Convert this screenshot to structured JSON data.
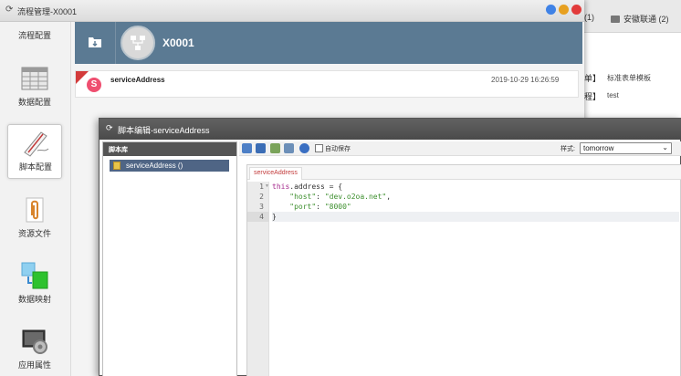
{
  "background": {
    "tabs": [
      {
        "label": "安徽联通 (2)"
      }
    ],
    "tab_count_partial": "(1)",
    "rows": [
      {
        "key": "单】",
        "value": "标准表单模板"
      },
      {
        "key": "程】",
        "value": "test"
      }
    ]
  },
  "flow_window": {
    "title": "流程管理-X0001",
    "nav": [
      {
        "label": "流程配置"
      },
      {
        "label": "数据配置"
      },
      {
        "label": "脚本配置"
      },
      {
        "label": "资源文件"
      },
      {
        "label": "数据映射"
      },
      {
        "label": "应用属性"
      }
    ],
    "header_title": "X0001",
    "script_row": {
      "name": "serviceAddress",
      "date": "2019-10-29 16:26:59"
    }
  },
  "editor_window": {
    "title": "脚本编辑-serviceAddress",
    "library_header": "脚本库",
    "library_items": [
      {
        "label": "serviceAddress ()"
      }
    ],
    "autosave_label": "自动保存",
    "style_label": "样式:",
    "style_value": "tomorrow",
    "code_tab": "serviceAddress",
    "line_numbers": [
      "1",
      "2",
      "3",
      "4"
    ]
  },
  "colors": {
    "header_bg": "#5b7a93",
    "accent_red": "#d33b3b",
    "library_selected": "#4f6585"
  }
}
